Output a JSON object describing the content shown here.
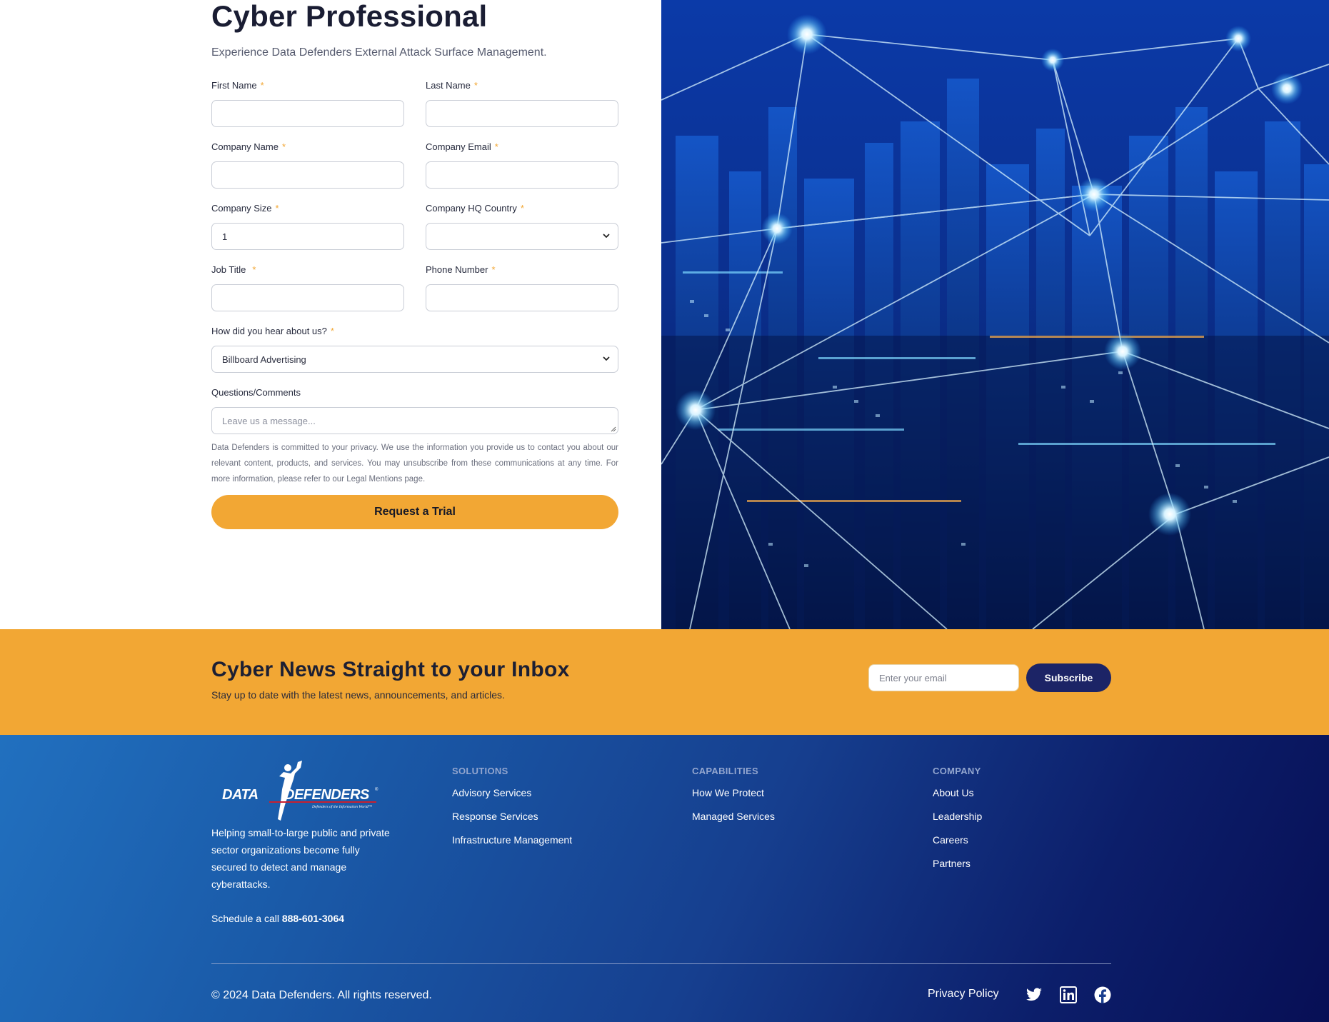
{
  "form": {
    "title": "Cyber Professional",
    "subtitle": "Experience Data Defenders External Attack Surface Management.",
    "required_mark": "*",
    "fields": {
      "first_name": {
        "label": "First Name",
        "value": ""
      },
      "last_name": {
        "label": "Last Name",
        "value": ""
      },
      "company_name": {
        "label": "Company Name",
        "value": ""
      },
      "company_email": {
        "label": "Company Email",
        "value": ""
      },
      "company_size": {
        "label": "Company Size",
        "value": "1"
      },
      "hq_country": {
        "label": "Company HQ Country",
        "value": ""
      },
      "job_title": {
        "label": "Job Title",
        "value": ""
      },
      "phone": {
        "label": "Phone Number",
        "value": ""
      },
      "heard": {
        "label": "How did you hear about us?",
        "value": "Billboard Advertising"
      },
      "comments": {
        "label": "Questions/Comments",
        "placeholder": "Leave us a message..."
      }
    },
    "privacy": "Data Defenders is committed to your privacy. We use the information you provide us to contact you about our relevant content, products, and services. You may unsubscribe from these communications at any time. For more information, please refer to our Legal Mentions page.",
    "submit_label": "Request a Trial"
  },
  "newsletter": {
    "title": "Cyber News Straight to your Inbox",
    "subtitle": "Stay up to date with the latest news, announcements, and articles.",
    "email_placeholder": "Enter your email",
    "subscribe_label": "Subscribe"
  },
  "footer": {
    "logo_text": "DATA DEFENDERS",
    "logo_tagline": "Defenders of the Information World",
    "about": "Helping small-to-large public and private sector organizations become fully secured to detect and manage cyberattacks.",
    "call_prefix": "Schedule a call",
    "phone": "888-601-3064",
    "solutions": {
      "heading": "SOLUTIONS",
      "links": [
        "Advisory Services",
        "Response Services",
        "Infrastructure Management"
      ]
    },
    "capabilities": {
      "heading": "CAPABILITIES",
      "links": [
        "How We Protect",
        "Managed Services"
      ]
    },
    "company": {
      "heading": "COMPANY",
      "links": [
        "About Us",
        "Leadership",
        "Careers",
        "Partners"
      ]
    },
    "copyright": "© 2024 Data Defenders. All rights reserved.",
    "privacy_policy": "Privacy Policy",
    "social_icons": [
      "twitter-icon",
      "linkedin-icon",
      "facebook-icon"
    ]
  },
  "colors": {
    "accent": "#f2a734",
    "navy_button": "#1c2466",
    "footer_start": "#2170bf",
    "footer_end": "#070f55"
  }
}
